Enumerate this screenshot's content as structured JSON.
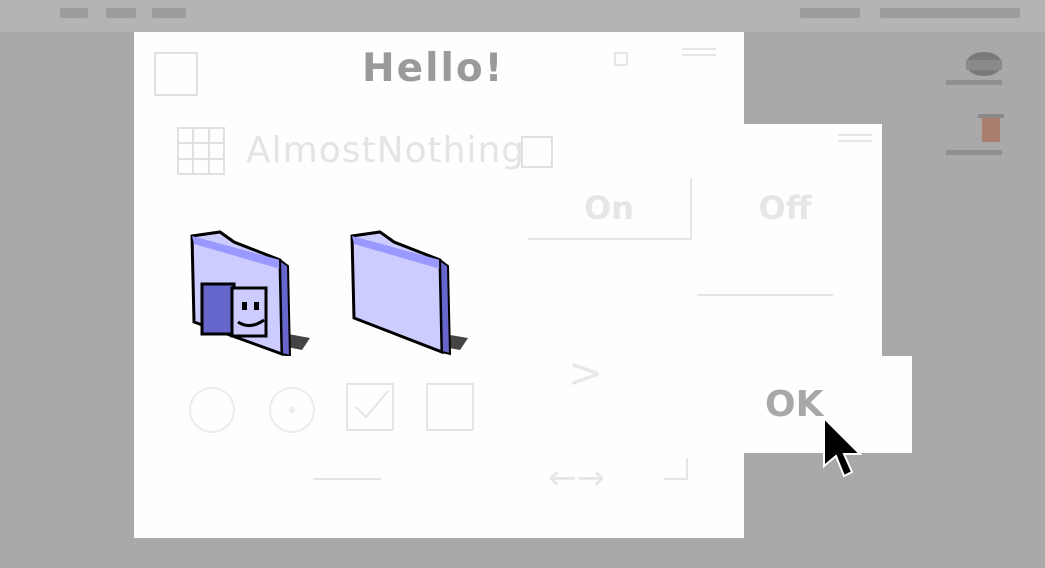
{
  "dialog": {
    "title": "Hello!",
    "text_field_value": "AlmostNothing",
    "segment_on_label": "On",
    "segment_off_label": "Off",
    "ok_label": "OK",
    "chevron_glyph": ">",
    "arrows_glyph": "←→"
  },
  "folders": [
    {
      "icon": "system-folder-icon"
    },
    {
      "icon": "folder-icon"
    }
  ],
  "colors": {
    "desktop": "#a9a9a9",
    "window": "#fefefe",
    "folder": "#ccccff",
    "folder_dark": "#6666cc"
  }
}
